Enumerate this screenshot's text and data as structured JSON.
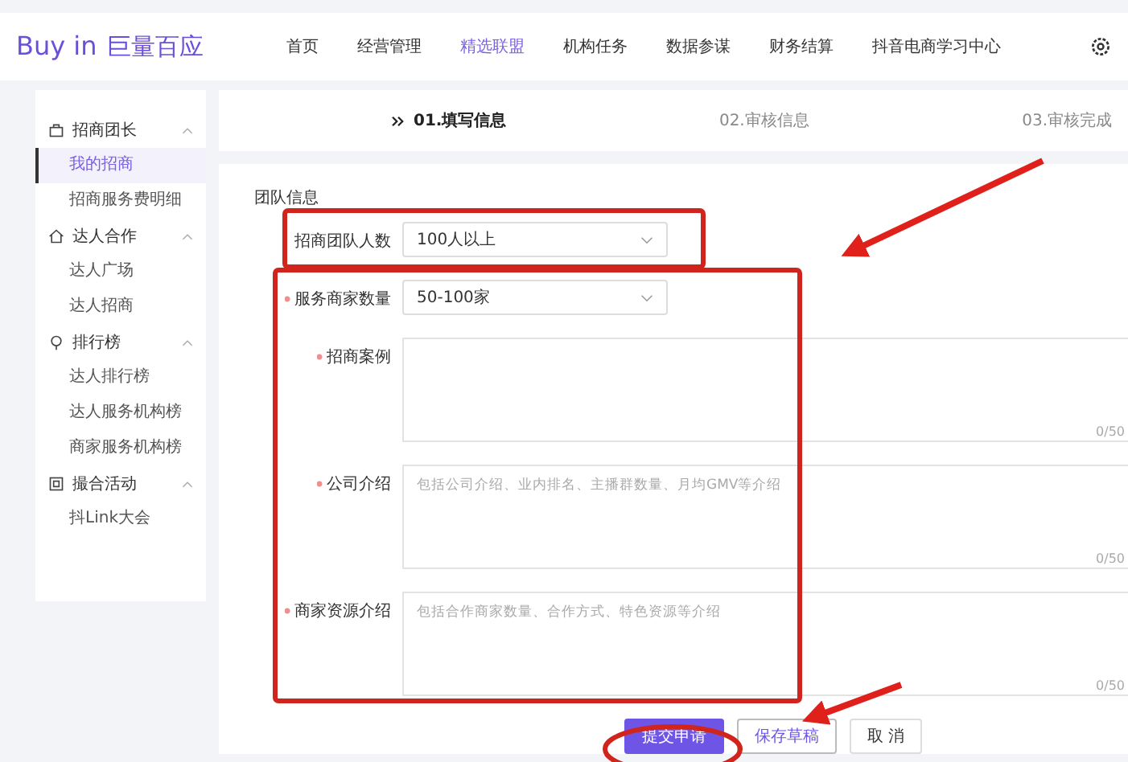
{
  "header": {
    "logo_latin": "Buy in",
    "logo_cjk": "巨量百应",
    "nav": [
      {
        "label": "首页",
        "selected": false
      },
      {
        "label": "经营管理",
        "selected": false
      },
      {
        "label": "精选联盟",
        "selected": true
      },
      {
        "label": "机构任务",
        "selected": false
      },
      {
        "label": "数据参谋",
        "selected": false
      },
      {
        "label": "财务结算",
        "selected": false
      },
      {
        "label": "抖音电商学习中心",
        "selected": false
      }
    ]
  },
  "sidebar": {
    "groups": [
      {
        "label": "招商团长",
        "expanded": true,
        "items": [
          {
            "label": "我的招商",
            "selected": true
          },
          {
            "label": "招商服务费明细",
            "selected": false
          }
        ]
      },
      {
        "label": "达人合作",
        "expanded": true,
        "items": [
          {
            "label": "达人广场",
            "selected": false
          },
          {
            "label": "达人招商",
            "selected": false
          }
        ]
      },
      {
        "label": "排行榜",
        "expanded": true,
        "items": [
          {
            "label": "达人排行榜",
            "selected": false
          },
          {
            "label": "达人服务机构榜",
            "selected": false
          },
          {
            "label": "商家服务机构榜",
            "selected": false
          }
        ]
      },
      {
        "label": "撮合活动",
        "expanded": true,
        "items": [
          {
            "label": "抖Link大会",
            "selected": false
          }
        ]
      }
    ]
  },
  "steps": [
    {
      "label": "01.填写信息",
      "active": true
    },
    {
      "label": "02.审核信息",
      "active": false
    },
    {
      "label": "03.审核完成",
      "active": false
    }
  ],
  "form": {
    "title": "团队信息",
    "fields": [
      {
        "kind": "select",
        "label": "招商团队人数",
        "required": false,
        "value": "100人以上"
      },
      {
        "kind": "select",
        "label": "服务商家数量",
        "required": true,
        "value": "50-100家"
      },
      {
        "kind": "textarea",
        "label": "招商案例",
        "required": true,
        "counter": "0/50"
      },
      {
        "kind": "textarea",
        "label": "公司介绍",
        "required": true,
        "placeholder": "包括公司介绍、业内排名、主播群数量、月均GMV等介绍",
        "counter": "0/50"
      },
      {
        "kind": "textarea",
        "label": "商家资源介绍",
        "required": true,
        "placeholder": "包括合作商家数量、合作方式、特色资源等介绍",
        "counter": "0/50"
      }
    ],
    "buttons": [
      {
        "label": "提交申请",
        "kind": "primary"
      },
      {
        "label": "保存草稿",
        "kind": "outline"
      },
      {
        "label": "取 消",
        "kind": "plain"
      }
    ]
  }
}
